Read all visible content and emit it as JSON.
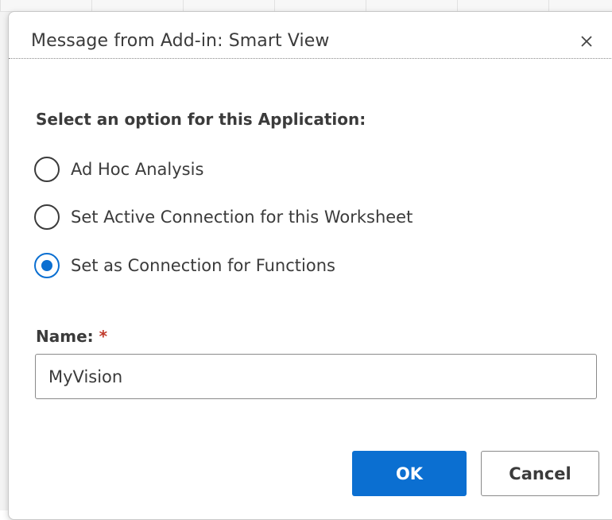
{
  "dialog": {
    "title": "Message from Add-in: Smart View",
    "close_icon": "close-icon"
  },
  "prompt": "Select an option for this Application:",
  "options": [
    {
      "label": "Ad Hoc Analysis",
      "selected": false
    },
    {
      "label": "Set Active Connection for this Worksheet",
      "selected": false
    },
    {
      "label": "Set as Connection for Functions",
      "selected": true
    }
  ],
  "name_field": {
    "label": "Name:",
    "required_marker": "*",
    "value": "MyVision"
  },
  "buttons": {
    "ok_label": "OK",
    "cancel_label": "Cancel"
  },
  "colors": {
    "accent": "#0b6fd1",
    "text": "#3b3b3b",
    "required": "#c0392b"
  }
}
